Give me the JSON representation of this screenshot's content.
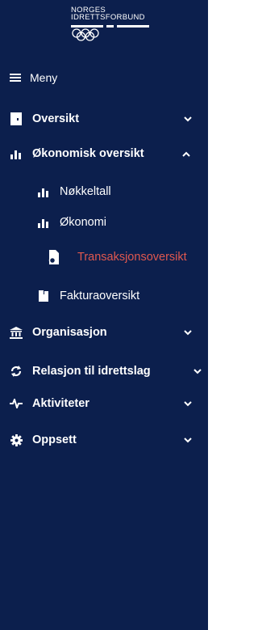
{
  "brand": {
    "line1": "NORGES",
    "line2": "IDRETTSFORBUND"
  },
  "menu_toggle": {
    "label": "Meny"
  },
  "nav": {
    "oversikt": "Oversikt",
    "okonomisk": "Økonomisk oversikt",
    "sub": {
      "nokkeltall": "Nøkkeltall",
      "okonomi": "Økonomi",
      "transaksjon": "Transaksjonsoversikt",
      "faktura": "Fakturaoversikt"
    },
    "organisasjon": "Organisasjon",
    "relasjon": "Relasjon til idrettslag",
    "aktiviteter": "Aktiviteter",
    "oppsett": "Oppsett"
  },
  "colors": {
    "sidebar_bg": "#0c1f4d",
    "active_text": "#e0584f",
    "text": "#ffffff"
  }
}
